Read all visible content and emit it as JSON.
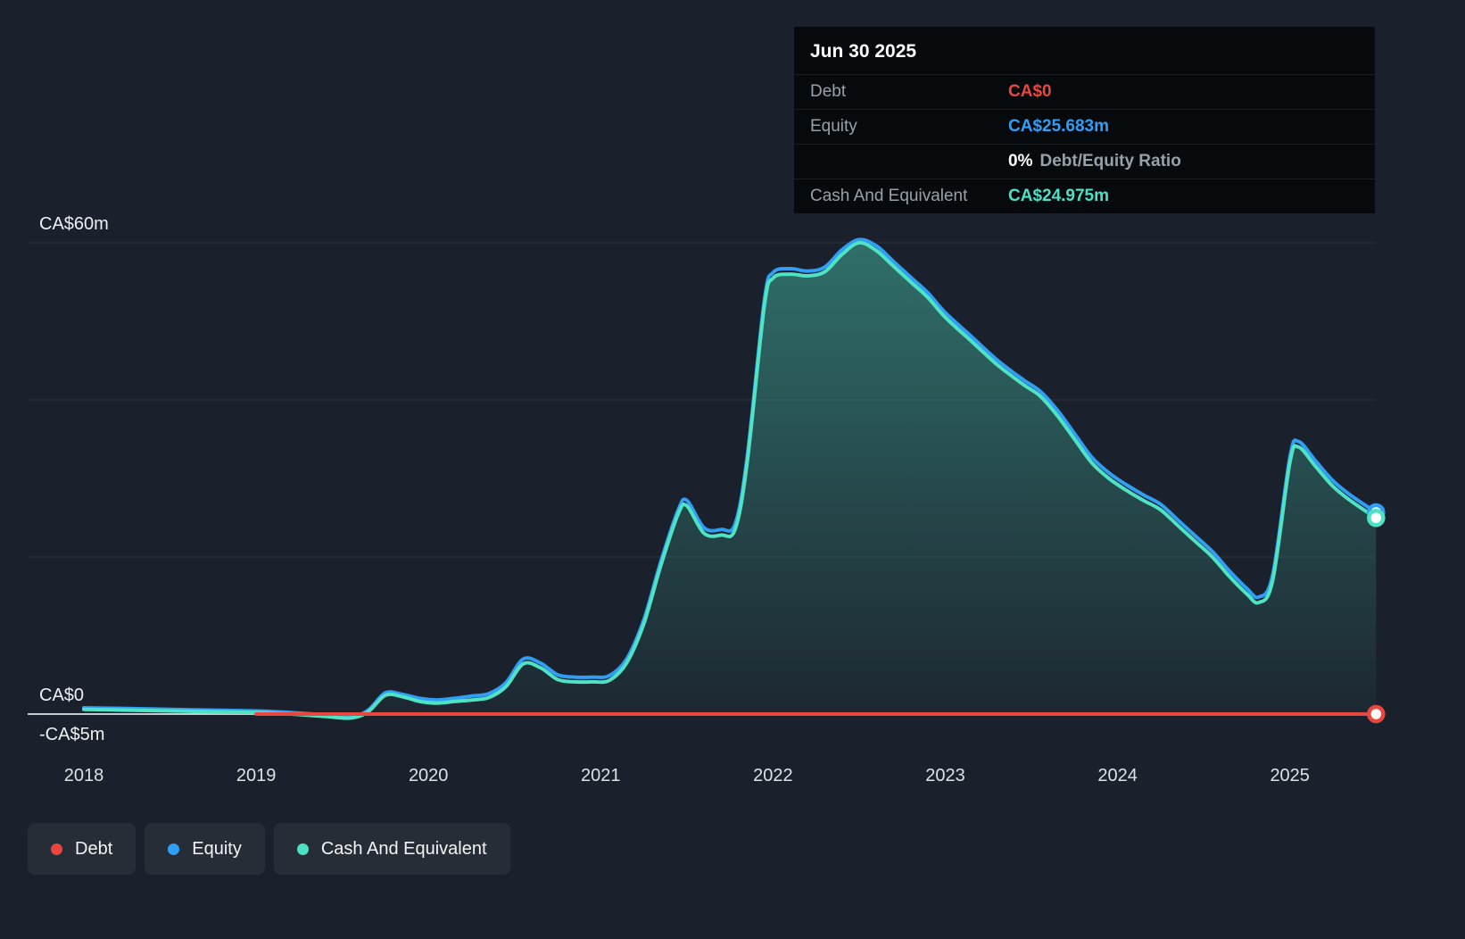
{
  "app": {
    "background": "#1b212c"
  },
  "tooltip": {
    "date": "Jun 30 2025",
    "debt_label": "Debt",
    "debt_value": "CA$0",
    "equity_label": "Equity",
    "equity_value": "CA$25.683m",
    "ratio_value": "0%",
    "ratio_label": "Debt/Equity Ratio",
    "cash_label": "Cash And Equivalent",
    "cash_value": "CA$24.975m",
    "colors": {
      "debt": "#e8473f",
      "equity": "#2f9ef4",
      "cash": "#4ce0c4"
    }
  },
  "legend": {
    "items": [
      {
        "label": "Debt",
        "color": "#e8473f"
      },
      {
        "label": "Equity",
        "color": "#2f9ef4"
      },
      {
        "label": "Cash And Equivalent",
        "color": "#4ce0c4"
      }
    ]
  },
  "chart_data": {
    "type": "area",
    "x_unit": "year",
    "x_ticks": [
      2018,
      2019,
      2020,
      2021,
      2022,
      2023,
      2024,
      2025
    ],
    "ylim": [
      -5,
      62
    ],
    "grid": true,
    "legend_position": "bottom-left",
    "y_gridlines": [
      0,
      20,
      40,
      60
    ],
    "y_axis_labels": [
      {
        "value": 60,
        "label": "CA$60m"
      },
      {
        "value": 0,
        "label": "CA$0"
      },
      {
        "value": -5,
        "label": "-CA$5m"
      }
    ],
    "x": [
      2018.0,
      2018.25,
      2018.5,
      2018.75,
      2019.0,
      2019.2,
      2019.4,
      2019.55,
      2019.65,
      2019.75,
      2019.85,
      2019.95,
      2020.05,
      2020.15,
      2020.25,
      2020.35,
      2020.45,
      2020.55,
      2020.65,
      2020.75,
      2020.85,
      2020.95,
      2021.05,
      2021.15,
      2021.25,
      2021.35,
      2021.45,
      2021.5,
      2021.6,
      2021.7,
      2021.78,
      2021.85,
      2021.95,
      2022.0,
      2022.1,
      2022.2,
      2022.3,
      2022.4,
      2022.5,
      2022.6,
      2022.7,
      2022.8,
      2022.9,
      2023.0,
      2023.15,
      2023.3,
      2023.45,
      2023.55,
      2023.65,
      2023.75,
      2023.85,
      2023.95,
      2024.05,
      2024.15,
      2024.25,
      2024.35,
      2024.45,
      2024.55,
      2024.65,
      2024.75,
      2024.82,
      2024.9,
      2025.0,
      2025.05,
      2025.15,
      2025.25,
      2025.35,
      2025.5
    ],
    "series": [
      {
        "name": "Equity",
        "color": "#2f9ef4",
        "end_marker": true,
        "values": [
          0.8,
          0.7,
          0.6,
          0.5,
          0.4,
          0.2,
          -0.1,
          -0.3,
          0.5,
          2.7,
          2.5,
          2.0,
          1.8,
          2.0,
          2.3,
          2.6,
          4.0,
          7.0,
          6.5,
          5.0,
          4.7,
          4.7,
          4.9,
          7.0,
          12.0,
          19.5,
          26.0,
          27.2,
          23.7,
          23.5,
          24.2,
          32.7,
          52.7,
          56.2,
          56.7,
          56.4,
          56.9,
          59.1,
          60.4,
          59.6,
          57.6,
          55.6,
          53.6,
          51.1,
          48.1,
          45.1,
          42.6,
          41.1,
          38.7,
          35.7,
          32.7,
          30.7,
          29.2,
          27.9,
          26.7,
          24.7,
          22.7,
          20.7,
          18.2,
          16.0,
          14.9,
          17.7,
          32.7,
          34.7,
          32.2,
          29.7,
          27.9,
          25.683
        ]
      },
      {
        "name": "Cash And Equivalent",
        "color": "#4fe3c4",
        "fill": true,
        "end_marker": true,
        "values": [
          0.6,
          0.5,
          0.4,
          0.3,
          0.2,
          0.0,
          -0.3,
          -0.5,
          0.3,
          2.4,
          2.2,
          1.6,
          1.4,
          1.6,
          1.8,
          2.1,
          3.5,
          6.4,
          5.9,
          4.4,
          4.1,
          4.1,
          4.3,
          6.5,
          11.5,
          19.0,
          25.5,
          26.5,
          23.0,
          22.8,
          23.5,
          32.0,
          52.0,
          55.5,
          56.0,
          55.8,
          56.3,
          58.5,
          60.0,
          59.0,
          57.0,
          55.0,
          53.0,
          50.5,
          47.5,
          44.5,
          42.0,
          40.5,
          38.0,
          35.0,
          32.0,
          30.0,
          28.5,
          27.2,
          26.0,
          24.0,
          22.0,
          20.0,
          17.5,
          15.3,
          14.2,
          17.0,
          32.0,
          34.0,
          31.5,
          29.0,
          27.2,
          24.975
        ]
      },
      {
        "name": "Debt",
        "color": "#e8473f",
        "end_marker": true,
        "x": [
          2019.0,
          2025.5
        ],
        "values": [
          0,
          0
        ]
      }
    ]
  }
}
